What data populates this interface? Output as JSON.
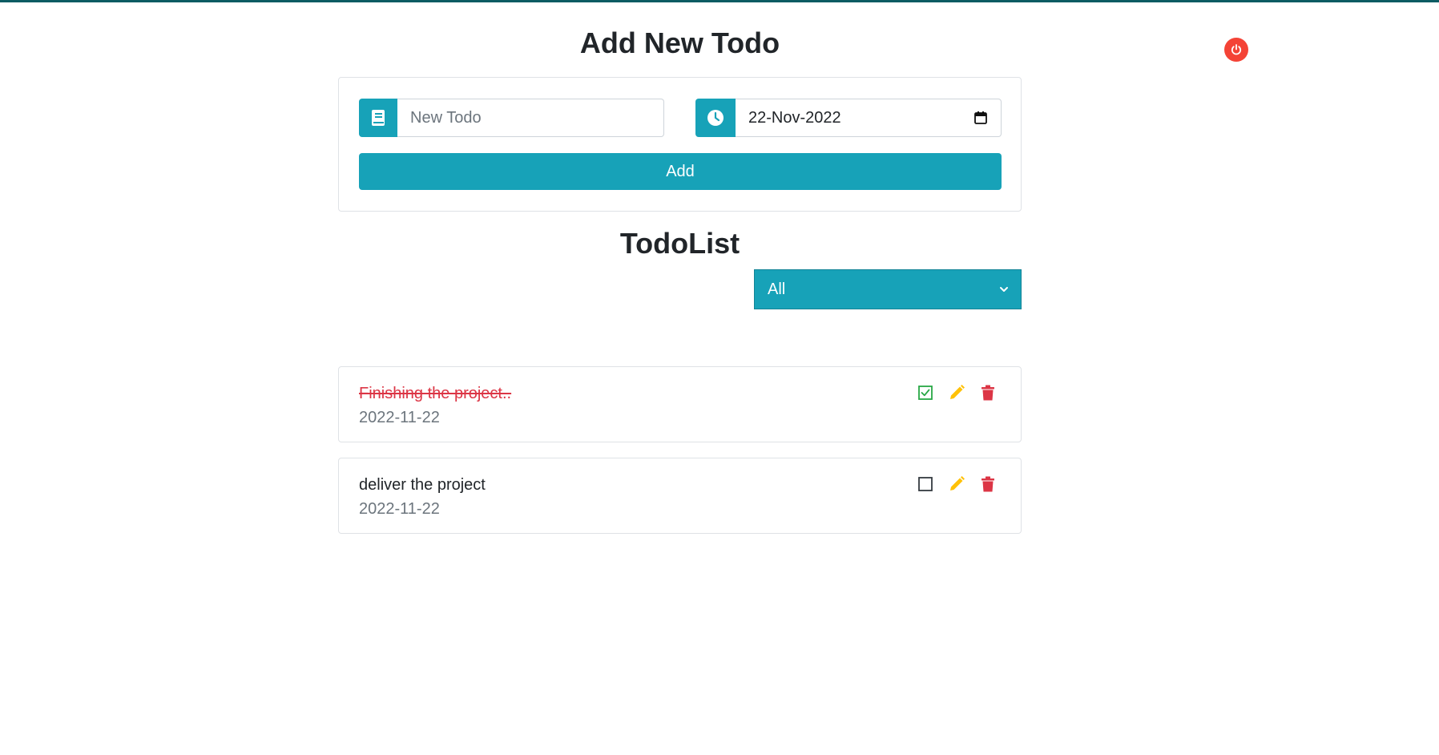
{
  "header": {
    "add_title": "Add New Todo",
    "list_title": "TodoList",
    "logout_icon": "power-icon"
  },
  "form": {
    "todo_input": {
      "placeholder": "New Todo",
      "value": "",
      "icon": "book-icon"
    },
    "date_input": {
      "value": "22-Nov-2022",
      "icon": "clock-icon",
      "picker_icon": "calendar-icon"
    },
    "add_label": "Add"
  },
  "filter": {
    "selected": "All"
  },
  "todos": [
    {
      "text": "Finishing the project..",
      "date": "2022-11-22",
      "completed": true
    },
    {
      "text": "deliver the project",
      "date": "2022-11-22",
      "completed": false
    }
  ],
  "colors": {
    "accent": "#17a2b8",
    "top_bar": "#0d5c63",
    "power": "#f44336",
    "edit": "#ffc107",
    "delete": "#dc3545",
    "check": "#28a745",
    "completed_text": "#dc3545"
  }
}
